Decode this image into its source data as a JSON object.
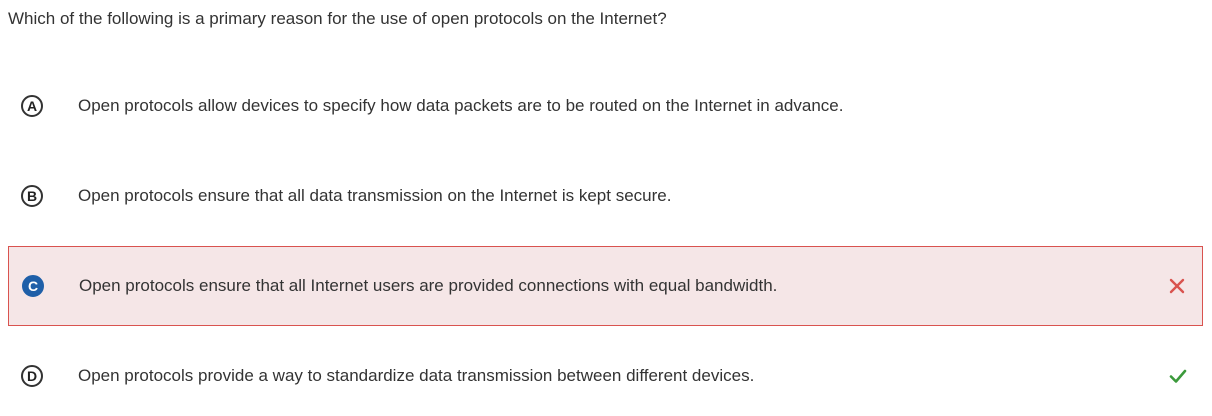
{
  "question": {
    "text": "Which of the following is a primary reason for the use of open protocols on the Internet?"
  },
  "options": [
    {
      "letter": "A",
      "text": "Open protocols allow devices to specify how data packets are to be routed on the Internet in advance.",
      "selected": false,
      "status": ""
    },
    {
      "letter": "B",
      "text": "Open protocols ensure that all data transmission on the Internet is kept secure.",
      "selected": false,
      "status": ""
    },
    {
      "letter": "C",
      "text": "Open protocols ensure that all Internet users are provided connections with equal bandwidth.",
      "selected": true,
      "status": "incorrect",
      "status_icon": "close-icon"
    },
    {
      "letter": "D",
      "text": "Open protocols provide a way to standardize data transmission between different devices.",
      "selected": false,
      "status": "correct",
      "status_icon": "check-icon"
    }
  ],
  "colors": {
    "selected_background": "#f5e6e7",
    "selected_border": "#d9534f",
    "selected_badge": "#1f5fa8",
    "incorrect_mark": "#d9534f",
    "correct_mark": "#3c9a3c"
  }
}
